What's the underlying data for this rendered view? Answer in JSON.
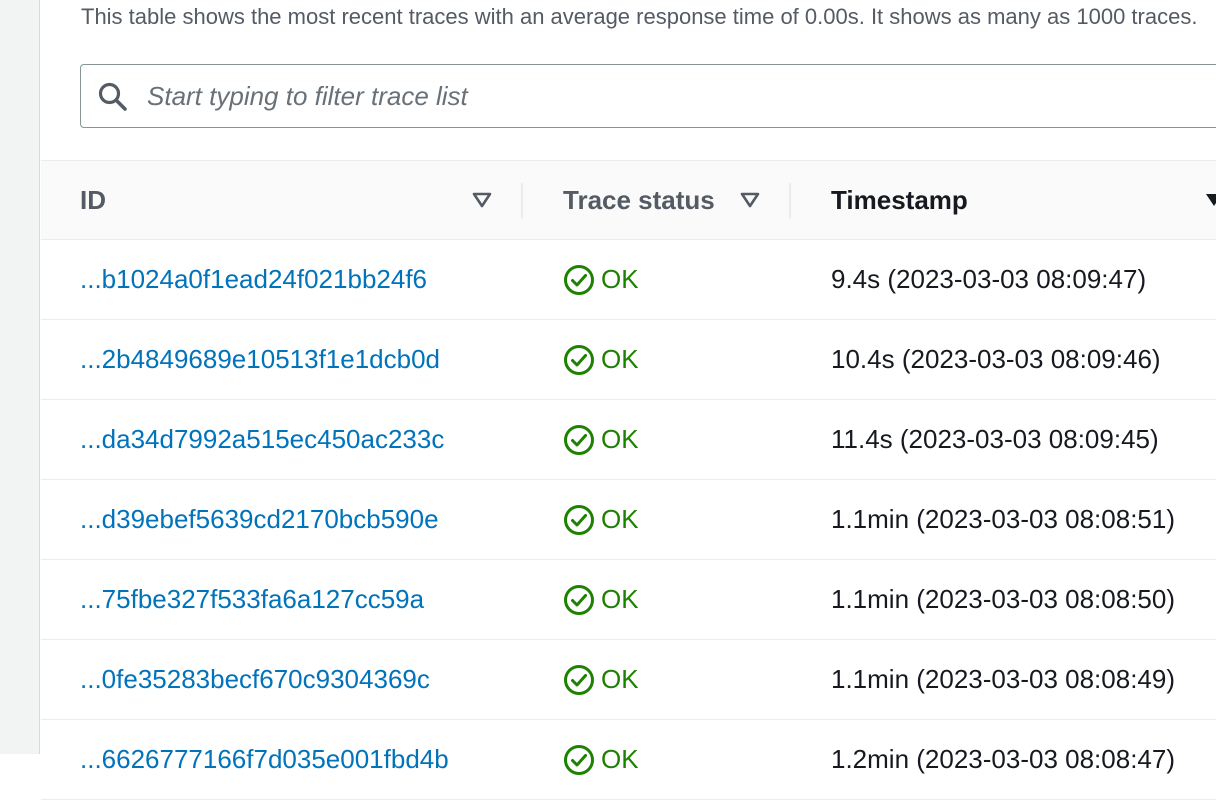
{
  "description": "This table shows the most recent traces with an average response time of 0.00s. It shows as many as 1000 traces.",
  "filter": {
    "placeholder": "Start typing to filter trace list",
    "value": ""
  },
  "columns": {
    "id": "ID",
    "status": "Trace status",
    "timestamp": "Timestamp"
  },
  "rows": [
    {
      "id": "...b1024a0f1ead24f021bb24f6",
      "status": "OK",
      "timestamp": "9.4s (2023-03-03 08:09:47)"
    },
    {
      "id": "...2b4849689e10513f1e1dcb0d",
      "status": "OK",
      "timestamp": "10.4s (2023-03-03 08:09:46)"
    },
    {
      "id": "...da34d7992a515ec450ac233c",
      "status": "OK",
      "timestamp": "11.4s (2023-03-03 08:09:45)"
    },
    {
      "id": "...d39ebef5639cd2170bcb590e",
      "status": "OK",
      "timestamp": "1.1min (2023-03-03 08:08:51)"
    },
    {
      "id": "...75fbe327f533fa6a127cc59a",
      "status": "OK",
      "timestamp": "1.1min (2023-03-03 08:08:50)"
    },
    {
      "id": "...0fe35283becf670c9304369c",
      "status": "OK",
      "timestamp": "1.1min (2023-03-03 08:08:49)"
    },
    {
      "id": "...6626777166f7d035e001fbd4b",
      "status": "OK",
      "timestamp": "1.2min (2023-03-03 08:08:47)"
    }
  ],
  "colors": {
    "link": "#0073bb",
    "ok": "#1d8102",
    "header_bg": "#fafafa"
  },
  "icons": {
    "search": "search-icon",
    "sort": "sort-caret-icon",
    "status": "check-circle-icon"
  }
}
